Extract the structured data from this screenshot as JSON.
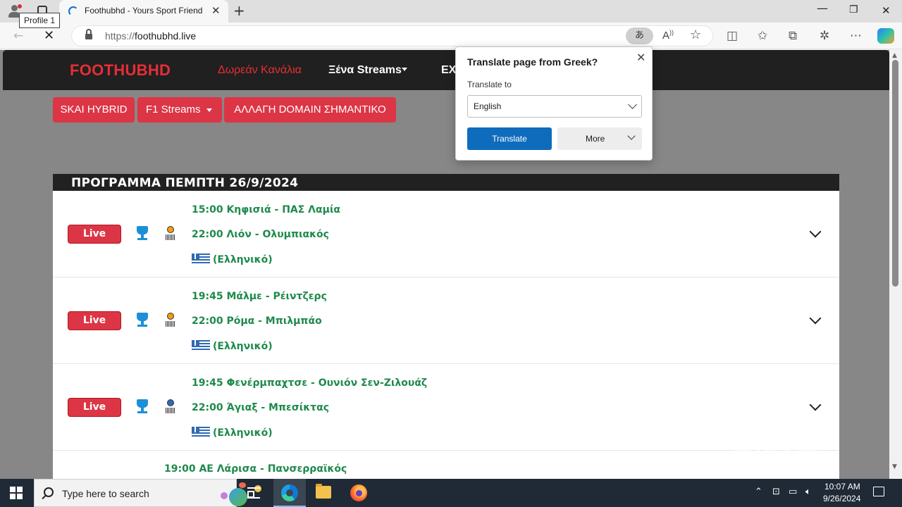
{
  "browser": {
    "profile_tooltip": "Profile 1",
    "tab_title": "Foothubhd - Yours Sport Friend",
    "tab_close": "✕",
    "new_tab": "+",
    "url_protocol": "https://",
    "url_host": "foothubhd.live",
    "translate_chip": "あ",
    "read_aloud": "A¹",
    "window": {
      "minimize": "—",
      "maximize": "❐",
      "close": "✕"
    }
  },
  "site": {
    "brand": "FOOTHUBHD",
    "nav": {
      "free_channels": "Δωρεάν Κανάλια",
      "foreign_streams": "Ξένα Streams",
      "ex": "EX"
    },
    "buttons": {
      "skai": "SKAI HYBRID",
      "f1": "F1 Streams",
      "domain": "ΑΛΛΑΓΗ DOMAIN ΣΗΜΑΝΤΙΚΟ"
    },
    "schedule_title": "ΠΡΟΓΡΑΜΜΑ ΠΕΜΠΤΗ 26/9/2024",
    "live_label": "Live",
    "matches": [
      {
        "line1": "15:00 Κηφισιά - ΠΑΣ Λαμία",
        "line2": "22:00 Λιόν - Ολυμπιακός",
        "language": "(Ελληνικό)",
        "icons": [
          "greek-cup-icon",
          "europa-league-icon"
        ]
      },
      {
        "line1": "19:45 Μάλμε - Ρέιντζερς",
        "line2": "22:00 Ρόμα - Μπιλμπάο",
        "language": "(Ελληνικό)",
        "icons": [
          "greek-cup-icon",
          "europa-league-icon"
        ]
      },
      {
        "line1": "19:45 Φενέρμπαχτσε - Ουνιόν Σεν-Ζιλουάζ",
        "line2": "22:00 Άγιαξ - Μπεσίκτας",
        "language": "(Ελληνικό)",
        "icons": [
          "greek-cup-icon",
          "tournament-icon"
        ]
      }
    ],
    "match_partial": "19:00 ΑΕ Λάρισα - Πανσερραϊκός",
    "watermark": {
      "left": "ANY",
      "right": "RUN"
    }
  },
  "translate_popup": {
    "title": "Translate page from Greek?",
    "close": "✕",
    "label": "Translate to",
    "selected_language": "English",
    "translate_button": "Translate",
    "more_button": "More"
  },
  "taskbar": {
    "search_placeholder": "Type here to search",
    "time": "10:07 AM",
    "date": "9/26/2024",
    "tray_chevron": "⌃"
  },
  "colors": {
    "brand_red": "#e62e36",
    "live_red": "#dc3545",
    "match_green": "#1e8a4c",
    "translate_blue": "#0f6cbd"
  }
}
